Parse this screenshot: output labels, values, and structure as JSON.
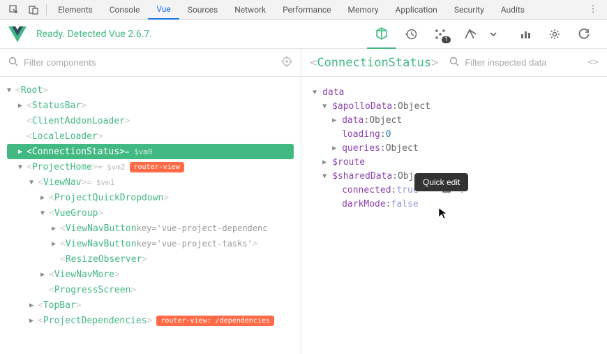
{
  "devtools": {
    "tabs": [
      "Elements",
      "Console",
      "Vue",
      "Sources",
      "Network",
      "Performance",
      "Memory",
      "Application",
      "Security",
      "Audits"
    ],
    "active": "Vue"
  },
  "vue_bar": {
    "ready": "Ready. Detected Vue 2.6.7.",
    "badge_count": "1"
  },
  "filter_left_placeholder": "Filter components",
  "filter_right_placeholder": "Filter inspected data",
  "selected_component": "ConnectionStatus",
  "tree": [
    {
      "depth": 0,
      "arrow": "▼",
      "name": "Root",
      "selected": false
    },
    {
      "depth": 1,
      "arrow": "▶",
      "name": "StatusBar",
      "selected": false
    },
    {
      "depth": 1,
      "arrow": "",
      "name": "ClientAddonLoader",
      "selected": false
    },
    {
      "depth": 1,
      "arrow": "",
      "name": "LocaleLoader",
      "selected": false
    },
    {
      "depth": 1,
      "arrow": "▶",
      "name": "ConnectionStatus",
      "suffix": " = $vm0",
      "selected": true
    },
    {
      "depth": 1,
      "arrow": "▼",
      "name": "ProjectHome",
      "suffix": " = $vm2",
      "pill": "router-view",
      "selected": false
    },
    {
      "depth": 2,
      "arrow": "▼",
      "name": "ViewNav",
      "suffix": " = $vm1",
      "selected": false
    },
    {
      "depth": 3,
      "arrow": "▶",
      "name": "ProjectQuickDropdown",
      "selected": false
    },
    {
      "depth": 3,
      "arrow": "▼",
      "name": "VueGroup",
      "selected": false
    },
    {
      "depth": 4,
      "arrow": "▶",
      "name": "ViewNavButton",
      "attr_key": "key",
      "attr_val": "'vue-project-dependenc",
      "selected": false
    },
    {
      "depth": 4,
      "arrow": "▶",
      "name": "ViewNavButton",
      "attr_key": "key",
      "attr_val": "'vue-project-tasks'",
      "close": true,
      "selected": false
    },
    {
      "depth": 4,
      "arrow": "",
      "name": "ResizeObserver",
      "selected": false
    },
    {
      "depth": 3,
      "arrow": "▶",
      "name": "ViewNavMore",
      "selected": false
    },
    {
      "depth": 3,
      "arrow": "",
      "name": "ProgressScreen",
      "selected": false
    },
    {
      "depth": 2,
      "arrow": "▶",
      "name": "TopBar",
      "selected": false
    },
    {
      "depth": 2,
      "arrow": "▶",
      "name": "ProjectDependencies",
      "pill": "router-view: /dependencies",
      "selected": false
    }
  ],
  "data": {
    "header": "data",
    "rows": [
      {
        "depth": 0,
        "arrow": "▼",
        "key": "$apolloData",
        "val": "Object",
        "type": "type"
      },
      {
        "depth": 1,
        "arrow": "▶",
        "key": "data",
        "val": "Object",
        "type": "type"
      },
      {
        "depth": 1,
        "arrow": "",
        "key": "loading",
        "val": "0",
        "type": "num"
      },
      {
        "depth": 1,
        "arrow": "▶",
        "key": "queries",
        "val": "Object",
        "type": "type"
      },
      {
        "depth": 0,
        "arrow": "▶",
        "key": "$route",
        "val": "",
        "type": ""
      },
      {
        "depth": 0,
        "arrow": "▼",
        "key": "$sharedData",
        "val": "Obj",
        "type": "type",
        "actions": true
      },
      {
        "depth": 1,
        "arrow": "",
        "key": "connected",
        "val": "true",
        "type": "bool-true",
        "row_actions": true
      },
      {
        "depth": 1,
        "arrow": "",
        "key": "darkMode",
        "val": "false",
        "type": "bool-false"
      }
    ]
  },
  "tooltip": "Quick edit"
}
